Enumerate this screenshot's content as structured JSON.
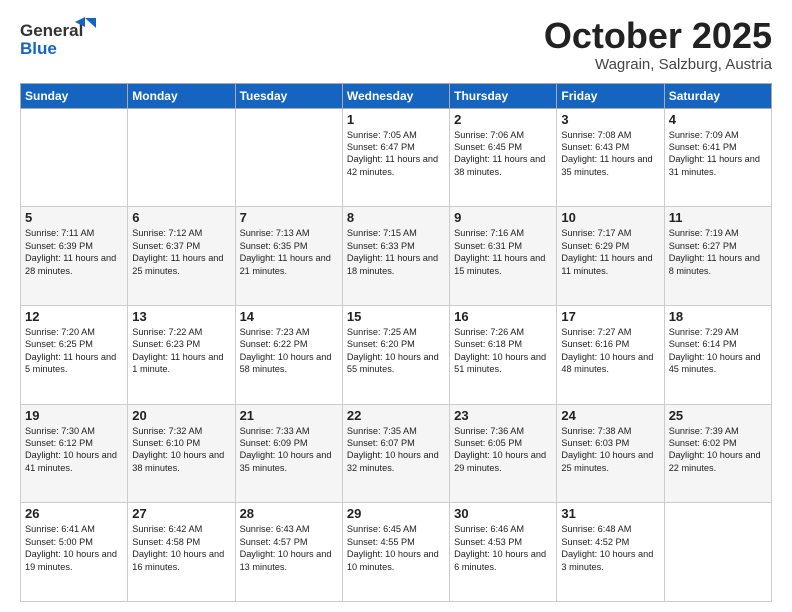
{
  "header": {
    "logo_general": "General",
    "logo_blue": "Blue",
    "title": "October 2025",
    "location": "Wagrain, Salzburg, Austria"
  },
  "days_of_week": [
    "Sunday",
    "Monday",
    "Tuesday",
    "Wednesday",
    "Thursday",
    "Friday",
    "Saturday"
  ],
  "weeks": [
    [
      {
        "day": "",
        "info": ""
      },
      {
        "day": "",
        "info": ""
      },
      {
        "day": "",
        "info": ""
      },
      {
        "day": "1",
        "info": "Sunrise: 7:05 AM\nSunset: 6:47 PM\nDaylight: 11 hours\nand 42 minutes."
      },
      {
        "day": "2",
        "info": "Sunrise: 7:06 AM\nSunset: 6:45 PM\nDaylight: 11 hours\nand 38 minutes."
      },
      {
        "day": "3",
        "info": "Sunrise: 7:08 AM\nSunset: 6:43 PM\nDaylight: 11 hours\nand 35 minutes."
      },
      {
        "day": "4",
        "info": "Sunrise: 7:09 AM\nSunset: 6:41 PM\nDaylight: 11 hours\nand 31 minutes."
      }
    ],
    [
      {
        "day": "5",
        "info": "Sunrise: 7:11 AM\nSunset: 6:39 PM\nDaylight: 11 hours\nand 28 minutes."
      },
      {
        "day": "6",
        "info": "Sunrise: 7:12 AM\nSunset: 6:37 PM\nDaylight: 11 hours\nand 25 minutes."
      },
      {
        "day": "7",
        "info": "Sunrise: 7:13 AM\nSunset: 6:35 PM\nDaylight: 11 hours\nand 21 minutes."
      },
      {
        "day": "8",
        "info": "Sunrise: 7:15 AM\nSunset: 6:33 PM\nDaylight: 11 hours\nand 18 minutes."
      },
      {
        "day": "9",
        "info": "Sunrise: 7:16 AM\nSunset: 6:31 PM\nDaylight: 11 hours\nand 15 minutes."
      },
      {
        "day": "10",
        "info": "Sunrise: 7:17 AM\nSunset: 6:29 PM\nDaylight: 11 hours\nand 11 minutes."
      },
      {
        "day": "11",
        "info": "Sunrise: 7:19 AM\nSunset: 6:27 PM\nDaylight: 11 hours\nand 8 minutes."
      }
    ],
    [
      {
        "day": "12",
        "info": "Sunrise: 7:20 AM\nSunset: 6:25 PM\nDaylight: 11 hours\nand 5 minutes."
      },
      {
        "day": "13",
        "info": "Sunrise: 7:22 AM\nSunset: 6:23 PM\nDaylight: 11 hours\nand 1 minute."
      },
      {
        "day": "14",
        "info": "Sunrise: 7:23 AM\nSunset: 6:22 PM\nDaylight: 10 hours\nand 58 minutes."
      },
      {
        "day": "15",
        "info": "Sunrise: 7:25 AM\nSunset: 6:20 PM\nDaylight: 10 hours\nand 55 minutes."
      },
      {
        "day": "16",
        "info": "Sunrise: 7:26 AM\nSunset: 6:18 PM\nDaylight: 10 hours\nand 51 minutes."
      },
      {
        "day": "17",
        "info": "Sunrise: 7:27 AM\nSunset: 6:16 PM\nDaylight: 10 hours\nand 48 minutes."
      },
      {
        "day": "18",
        "info": "Sunrise: 7:29 AM\nSunset: 6:14 PM\nDaylight: 10 hours\nand 45 minutes."
      }
    ],
    [
      {
        "day": "19",
        "info": "Sunrise: 7:30 AM\nSunset: 6:12 PM\nDaylight: 10 hours\nand 41 minutes."
      },
      {
        "day": "20",
        "info": "Sunrise: 7:32 AM\nSunset: 6:10 PM\nDaylight: 10 hours\nand 38 minutes."
      },
      {
        "day": "21",
        "info": "Sunrise: 7:33 AM\nSunset: 6:09 PM\nDaylight: 10 hours\nand 35 minutes."
      },
      {
        "day": "22",
        "info": "Sunrise: 7:35 AM\nSunset: 6:07 PM\nDaylight: 10 hours\nand 32 minutes."
      },
      {
        "day": "23",
        "info": "Sunrise: 7:36 AM\nSunset: 6:05 PM\nDaylight: 10 hours\nand 29 minutes."
      },
      {
        "day": "24",
        "info": "Sunrise: 7:38 AM\nSunset: 6:03 PM\nDaylight: 10 hours\nand 25 minutes."
      },
      {
        "day": "25",
        "info": "Sunrise: 7:39 AM\nSunset: 6:02 PM\nDaylight: 10 hours\nand 22 minutes."
      }
    ],
    [
      {
        "day": "26",
        "info": "Sunrise: 6:41 AM\nSunset: 5:00 PM\nDaylight: 10 hours\nand 19 minutes."
      },
      {
        "day": "27",
        "info": "Sunrise: 6:42 AM\nSunset: 4:58 PM\nDaylight: 10 hours\nand 16 minutes."
      },
      {
        "day": "28",
        "info": "Sunrise: 6:43 AM\nSunset: 4:57 PM\nDaylight: 10 hours\nand 13 minutes."
      },
      {
        "day": "29",
        "info": "Sunrise: 6:45 AM\nSunset: 4:55 PM\nDaylight: 10 hours\nand 10 minutes."
      },
      {
        "day": "30",
        "info": "Sunrise: 6:46 AM\nSunset: 4:53 PM\nDaylight: 10 hours\nand 6 minutes."
      },
      {
        "day": "31",
        "info": "Sunrise: 6:48 AM\nSunset: 4:52 PM\nDaylight: 10 hours\nand 3 minutes."
      },
      {
        "day": "",
        "info": ""
      }
    ]
  ]
}
